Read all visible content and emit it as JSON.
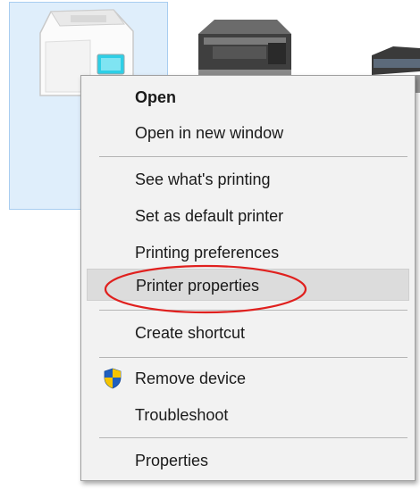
{
  "context_menu": {
    "items": [
      {
        "label": "Open",
        "bold": true
      },
      {
        "label": "Open in new window"
      },
      {
        "label": "See what's printing"
      },
      {
        "label": "Set as default printer"
      },
      {
        "label": "Printing preferences"
      },
      {
        "label": "Printer properties",
        "hovered": true,
        "annotated": true
      },
      {
        "label": "Create shortcut"
      },
      {
        "label": "Remove device",
        "icon": "uac-shield-icon"
      },
      {
        "label": "Troubleshoot"
      },
      {
        "label": "Properties"
      }
    ]
  },
  "colors": {
    "menu_background": "#f2f2f2",
    "hover_background": "#dcdcdc",
    "annotation_ellipse": "#e0201e",
    "selected_tile_background": "#dfeefb",
    "shield_blue": "#1f5fbf",
    "shield_yellow": "#f5c400"
  }
}
